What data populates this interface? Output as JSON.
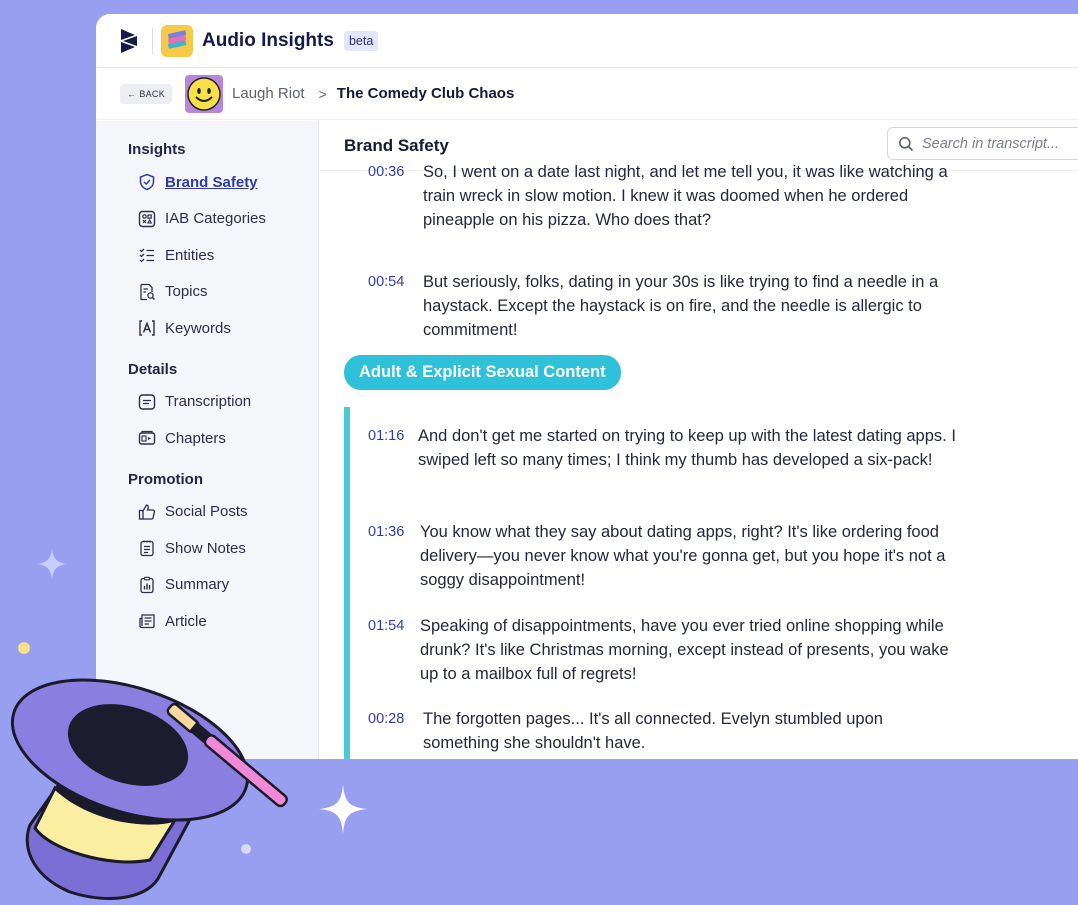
{
  "app": {
    "title": "Audio Insights",
    "badge": "beta",
    "accent": "#2f3cb0",
    "teal": "#2fc1d9"
  },
  "breadcrumb": {
    "back_label": "BACK",
    "parent": "Laugh Riot",
    "separator": ">",
    "current": "The Comedy Club Chaos"
  },
  "sidebar": {
    "sections": [
      {
        "title": "Insights",
        "items": [
          {
            "label": "Brand Safety",
            "icon": "shield-check-icon",
            "active": true
          },
          {
            "label": "IAB Categories",
            "icon": "category-grid-icon",
            "active": false
          },
          {
            "label": "Entities",
            "icon": "list-check-icon",
            "active": false
          },
          {
            "label": "Topics",
            "icon": "document-search-icon",
            "active": false
          },
          {
            "label": "Keywords",
            "icon": "keyword-box-icon",
            "active": false
          }
        ]
      },
      {
        "title": "Details",
        "items": [
          {
            "label": "Transcription",
            "icon": "transcript-box-icon",
            "active": false
          },
          {
            "label": "Chapters",
            "icon": "chapters-icon",
            "active": false
          }
        ]
      },
      {
        "title": "Promotion",
        "items": [
          {
            "label": "Social Posts",
            "icon": "thumbs-up-icon",
            "active": false
          },
          {
            "label": "Show Notes",
            "icon": "notes-icon",
            "active": false
          },
          {
            "label": "Summary",
            "icon": "clipboard-chart-icon",
            "active": false
          },
          {
            "label": "Article",
            "icon": "newspaper-icon",
            "active": false
          }
        ]
      }
    ]
  },
  "main": {
    "title": "Brand Safety",
    "search_placeholder": "Search in transcript...",
    "category_pill": "Adult & Explicit Sexual Content",
    "segments": [
      {
        "time": "00:36",
        "text": "So, I went on a date last night, and let me tell you, it was like watching a train wreck in slow motion. I knew it was doomed when he ordered pineapple on his pizza. Who does that?"
      },
      {
        "time": "00:54",
        "text": "But seriously, folks, dating in your 30s is like trying to find a needle in a haystack. Except the haystack is on fire, and the needle is allergic to commitment!"
      },
      {
        "time": "01:16",
        "text": "And don't get me started on trying to keep up with the latest dating apps. I swiped left so many times; I think my thumb has developed a six-pack!"
      },
      {
        "time": "01:36",
        "text": "You know what they say about dating apps, right? It's like ordering food delivery—you never know what you're gonna get, but you hope it's not a soggy disappointment!"
      },
      {
        "time": "01:54",
        "text": "Speaking of disappointments, have you ever tried online shopping while drunk? It's like Christmas morning, except instead of presents, you wake up to a mailbox full of regrets!"
      },
      {
        "time": "00:28",
        "text": "The forgotten pages... It's all connected. Evelyn stumbled upon something she shouldn't have."
      }
    ]
  }
}
